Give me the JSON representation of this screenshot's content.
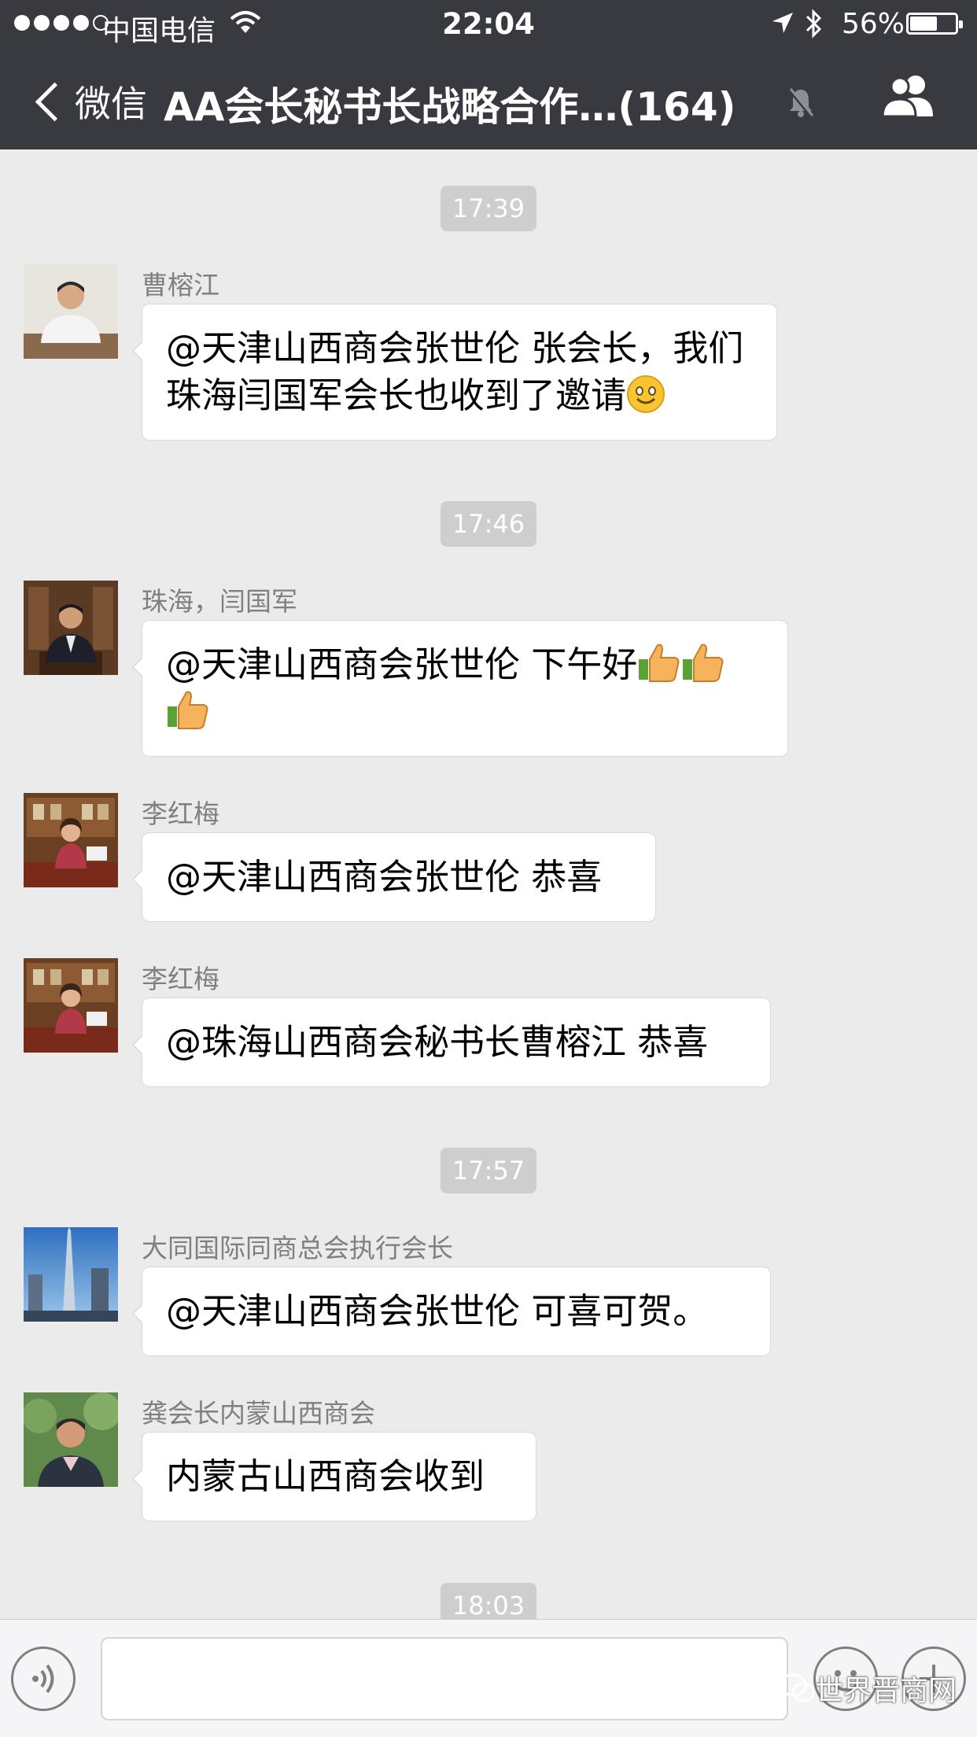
{
  "status_bar": {
    "carrier": "中国电信",
    "time": "22:04",
    "battery": "56%",
    "battery_level": 0.56,
    "icons": [
      "signal-dots-icon",
      "wifi-icon",
      "location-arrow-icon",
      "bluetooth-icon",
      "battery-icon"
    ]
  },
  "nav": {
    "back_label": "微信",
    "title": "AA会长秘书长战略合作…(164)",
    "icons": [
      "chevron-left-icon",
      "mute-bell-icon",
      "group-members-icon"
    ]
  },
  "chat": {
    "timestamps": [
      "17:39",
      "17:46",
      "17:57",
      "18:03"
    ],
    "messages": [
      {
        "sender": "曹榕江",
        "text": "@天津山西商会张世伦 张会长，我们珠海闫国军会长也收到了邀请",
        "emoji": [
          "smile-emoji"
        ]
      },
      {
        "sender": "珠海，闫国军",
        "text": "@天津山西商会张世伦 下午好",
        "emoji": [
          "thumbs-up-emoji",
          "thumbs-up-emoji",
          "thumbs-up-emoji"
        ]
      },
      {
        "sender": "李红梅",
        "text": "@天津山西商会张世伦 恭喜"
      },
      {
        "sender": "李红梅",
        "text": "@珠海山西商会秘书长曹榕江 恭喜"
      },
      {
        "sender": "大同国际同商总会执行会长",
        "text": "@天津山西商会张世伦 可喜可贺。"
      },
      {
        "sender": "龚会长内蒙山西商会",
        "text": "内蒙古山西商会收到"
      }
    ]
  },
  "input_bar": {
    "icons": [
      "voice-icon",
      "emoji-icon",
      "plus-icon"
    ],
    "text": ""
  },
  "watermark": "世界晋商网",
  "colors": {
    "nav_bg": "#393a3f",
    "chat_bg": "#ebebeb",
    "bubble_bg": "#ffffff",
    "timestamp_bg": "#cecece",
    "sender_text": "#808080"
  }
}
